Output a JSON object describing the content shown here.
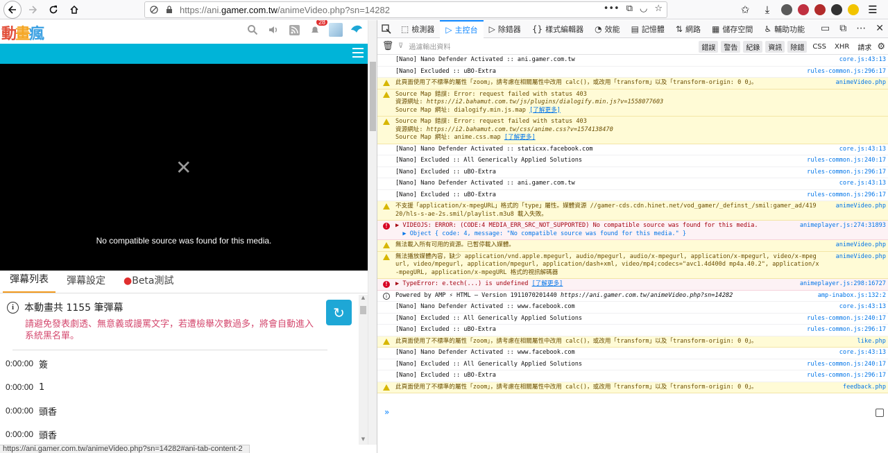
{
  "browser": {
    "url_prefix": "https://ani.",
    "url_domain": "gamer.com.tw",
    "url_path": "/animeVideo.php?sn=14282",
    "page_actions_icon": "•••"
  },
  "site": {
    "logo_chars": [
      "動",
      "畫",
      "瘋"
    ],
    "notification_count": "28"
  },
  "player": {
    "close_glyph": "✕",
    "message": "No compatible source was found for this media."
  },
  "tabs": [
    {
      "label": "彈幕列表"
    },
    {
      "label": "彈幕設定"
    },
    {
      "label": "Beta測試",
      "dot": "●"
    }
  ],
  "danmaku": {
    "info_icon": "i",
    "total_prefix": "本動畫共",
    "total_count": "1155",
    "total_suffix": "筆彈幕",
    "warning": "請避免發表劇透、無意義或謾罵文字，若遭檢舉次數過多，將會自動進入系統黑名單。",
    "refresh_glyph": "↻",
    "rows": [
      {
        "time": "0:00:00",
        "text": "簽"
      },
      {
        "time": "0:00:00",
        "text": "1"
      },
      {
        "time": "0:00:00",
        "text": "頭香"
      },
      {
        "time": "0:00:00",
        "text": "頭香"
      }
    ]
  },
  "status_url": "https://ani.gamer.com.tw/animeVideo.php?sn=14282#ani-tab-content-2",
  "devtools": {
    "tabs": [
      {
        "icon": "⬚",
        "label": "檢測器"
      },
      {
        "icon": "▷",
        "label": "主控台",
        "active": true
      },
      {
        "icon": "▷",
        "label": "除錯器"
      },
      {
        "icon": "{}",
        "label": "樣式編輯器"
      },
      {
        "icon": "◔",
        "label": "效能"
      },
      {
        "icon": "▤",
        "label": "記憶體"
      },
      {
        "icon": "⇅",
        "label": "網路"
      },
      {
        "icon": "▦",
        "label": "儲存空間"
      },
      {
        "icon": "♿",
        "label": "輔助功能"
      }
    ],
    "filter_placeholder": "過濾輸出資料",
    "filter_buttons": [
      "錯誤",
      "警告",
      "紀錄",
      "資訊",
      "除錯"
    ],
    "filter_extra": [
      "CSS",
      "XHR",
      "請求"
    ],
    "console": [
      {
        "level": "log",
        "text": "[Nano] Nano Defender Activated :: ani.gamer.com.tw",
        "source": "core.js:43:13"
      },
      {
        "level": "log",
        "text": "[Nano] Excluded :: uBO-Extra",
        "source": "rules-common.js:296:17"
      },
      {
        "level": "warn",
        "text": "此頁面使用了不標準的屬性「zoom」，請考慮在相關屬性中改用 calc()，或改用「transform」以及「transform-origin: 0 0」。",
        "source": "animeVideo.php"
      },
      {
        "level": "warn",
        "text": "Source Map 錯誤: Error: request failed with status 403\n資源網址: ",
        "url": "https://i2.bahamut.com.tw/js/plugins/dialogify.min.js?v=1558077603",
        "text2": "\nSource Map 網址: dialogify.min.js.map ",
        "link": "[了解更多]",
        "source": ""
      },
      {
        "level": "warn",
        "text": "Source Map 錯誤: Error: request failed with status 403\n資源網址: ",
        "url": "https://i2.bahamut.com.tw/css/anime.css?v=1574138470",
        "text2": "\nSource Map 網址: anime.css.map ",
        "link": "[了解更多]",
        "source": ""
      },
      {
        "level": "log",
        "text": "[Nano] Nano Defender Activated :: staticxx.facebook.com",
        "source": "core.js:43:13"
      },
      {
        "level": "log",
        "text": "[Nano] Excluded :: All Generically Applied Solutions",
        "source": "rules-common.js:240:17"
      },
      {
        "level": "log",
        "text": "[Nano] Excluded :: uBO-Extra",
        "source": "rules-common.js:296:17"
      },
      {
        "level": "log",
        "text": "[Nano] Nano Defender Activated :: ani.gamer.com.tw",
        "source": "core.js:43:13"
      },
      {
        "level": "log",
        "text": "[Nano] Excluded :: uBO-Extra",
        "source": "rules-common.js:296:17"
      },
      {
        "level": "warn",
        "text": "不支援「application/x-mpegURL」格式的「type」屬性。媒體資源 //gamer-cds.cdn.hinet.net/vod_gamer/_definst_/smil:gamer_ad/41920/hls-s-ae-2s.smil/playlist.m3u8 載入失敗。",
        "source": "animeVideo.php"
      },
      {
        "level": "error",
        "text": "▶ VIDEOJS: ERROR: (CODE:4 MEDIA_ERR_SRC_NOT_SUPPORTED) No compatible source was found for this media.",
        "obj": "\n  ▶ Object { code: 4, message: \"No compatible source was found for this media.\" }",
        "source": "animeplayer.js:274:31893"
      },
      {
        "level": "warn",
        "text": "無法載入所有可用的資源。已暫停載入媒體。",
        "source": "animeVideo.php"
      },
      {
        "level": "warn",
        "text": "無法播放媒體內容，缺少 application/vnd.apple.mpegurl, audio/mpegurl, audio/x-mpegurl, application/x-mpegurl, video/x-mpegurl, video/mpegurl, application/mpegurl, application/dash+xml, video/mp4;codecs=\"avc1.4d400d mp4a.40.2\", application/x-mpegURL, application/x-mpegURL 格式的視訊解碼器",
        "source": "animeVideo.php"
      },
      {
        "level": "error",
        "text": "▶ TypeError: e.tech(...) is undefined ",
        "link": "[了解更多]",
        "source": "animeplayer.js:298:16727"
      },
      {
        "level": "info",
        "text": "Powered by AMP ⚡ HTML – Version 1911070201440 ",
        "url": "https://ani.gamer.com.tw/animeVideo.php?sn=14282",
        "source": "amp-inabox.js:132:2"
      },
      {
        "level": "log",
        "text": "[Nano] Nano Defender Activated :: www.facebook.com",
        "source": "core.js:43:13"
      },
      {
        "level": "log",
        "text": "[Nano] Excluded :: All Generically Applied Solutions",
        "source": "rules-common.js:240:17"
      },
      {
        "level": "log",
        "text": "[Nano] Excluded :: uBO-Extra",
        "source": "rules-common.js:296:17"
      },
      {
        "level": "warn",
        "text": "此頁面使用了不標準的屬性「zoom」，請考慮在相關屬性中改用 calc()，或改用「transform」以及「transform-origin: 0 0」。",
        "source": "like.php"
      },
      {
        "level": "log",
        "text": "[Nano] Nano Defender Activated :: www.facebook.com",
        "source": "core.js:43:13"
      },
      {
        "level": "log",
        "text": "[Nano] Excluded :: All Generically Applied Solutions",
        "source": "rules-common.js:240:17"
      },
      {
        "level": "log",
        "text": "[Nano] Excluded :: uBO-Extra",
        "source": "rules-common.js:296:17"
      },
      {
        "level": "warn",
        "text": "此頁面使用了不標準的屬性「zoom」，請考慮在相關屬性中改用 calc()，或改用「transform」以及「transform-origin: 0 0」。",
        "source": "feedback.php"
      }
    ],
    "prompt_glyph": "»"
  },
  "colors": {
    "site_accent": "#00b4d8",
    "tab_underline": "#f29a1e",
    "warning_text": "#d4486e",
    "devtools_active": "#0a84ff"
  }
}
